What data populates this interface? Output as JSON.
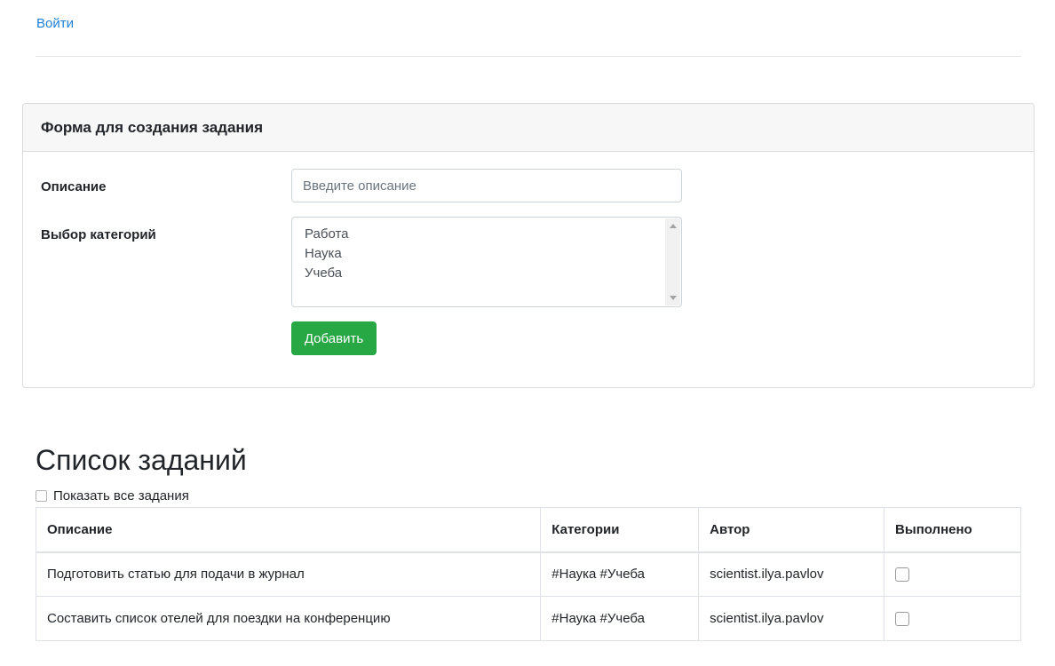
{
  "nav": {
    "login_label": "Войти"
  },
  "form": {
    "title": "Форма для создания задания",
    "description_label": "Описание",
    "description_placeholder": "Введите описание",
    "category_label": "Выбор категорий",
    "categories": [
      "Работа",
      "Наука",
      "Учеба"
    ],
    "add_button": "Добавить"
  },
  "list": {
    "title": "Список заданий",
    "show_all_label": "Показать все задания",
    "columns": [
      "Описание",
      "Категории",
      "Автор",
      "Выполнено"
    ],
    "rows": [
      {
        "description": "Подготовить статью для подачи в журнал",
        "categories": "#Наука #Учеба",
        "author": "scientist.ilya.pavlov",
        "done": false
      },
      {
        "description": "Составить список отелей для поездки на конференцию",
        "categories": "#Наука #Учеба",
        "author": "scientist.ilya.pavlov",
        "done": false
      }
    ]
  },
  "colors": {
    "link": "#1e7fd6",
    "success": "#28a745"
  }
}
